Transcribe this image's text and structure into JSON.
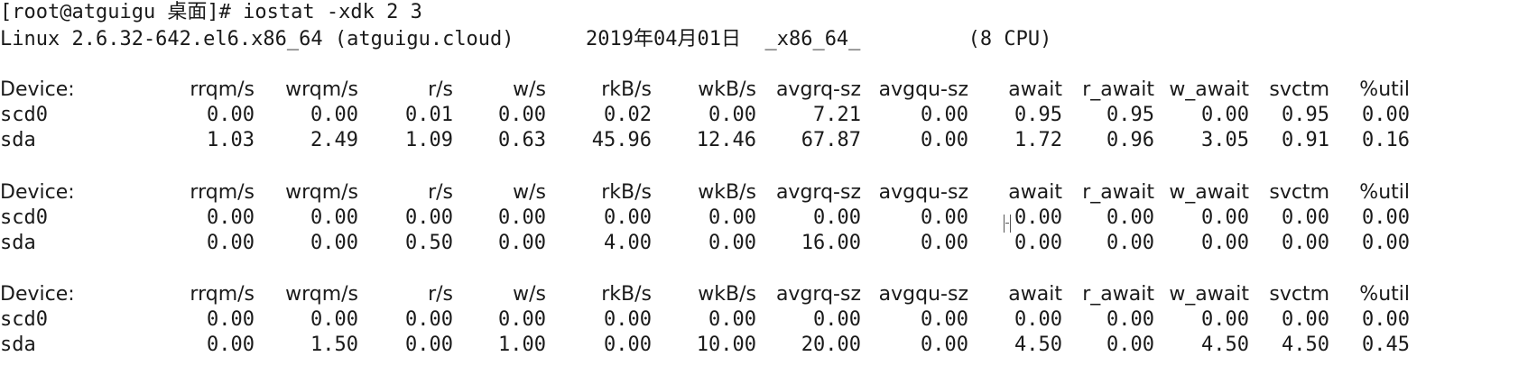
{
  "terminal": {
    "prompt_line": "[root@atguigu 桌面]# iostat -xdk 2 3",
    "sysinfo_line": "Linux 2.6.32-642.el6.x86_64 (atguigu.cloud)      2019年04月01日  _x86_64_         (8 CPU)",
    "columns": [
      "Device:",
      "rrqm/s",
      "wrqm/s",
      "r/s",
      "w/s",
      "rkB/s",
      "wkB/s",
      "avgrq-sz",
      "avgqu-sz",
      "await",
      "r_await",
      "w_await",
      "svctm",
      "%util"
    ],
    "reports": [
      {
        "rows": [
          [
            "scd0",
            "0.00",
            "0.00",
            "0.01",
            "0.00",
            "0.02",
            "0.00",
            "7.21",
            "0.00",
            "0.95",
            "0.95",
            "0.00",
            "0.95",
            "0.00"
          ],
          [
            "sda",
            "1.03",
            "2.49",
            "1.09",
            "0.63",
            "45.96",
            "12.46",
            "67.87",
            "0.00",
            "1.72",
            "0.96",
            "3.05",
            "0.91",
            "0.16"
          ]
        ]
      },
      {
        "rows": [
          [
            "scd0",
            "0.00",
            "0.00",
            "0.00",
            "0.00",
            "0.00",
            "0.00",
            "0.00",
            "0.00",
            "0.00",
            "0.00",
            "0.00",
            "0.00",
            "0.00"
          ],
          [
            "sda",
            "0.00",
            "0.00",
            "0.50",
            "0.00",
            "4.00",
            "0.00",
            "16.00",
            "0.00",
            "0.00",
            "0.00",
            "0.00",
            "0.00",
            "0.00"
          ]
        ]
      },
      {
        "rows": [
          [
            "scd0",
            "0.00",
            "0.00",
            "0.00",
            "0.00",
            "0.00",
            "0.00",
            "0.00",
            "0.00",
            "0.00",
            "0.00",
            "0.00",
            "0.00",
            "0.00"
          ],
          [
            "sda",
            "0.00",
            "1.50",
            "0.00",
            "1.00",
            "0.00",
            "10.00",
            "20.00",
            "0.00",
            "4.50",
            "0.00",
            "4.50",
            "4.50",
            "0.45"
          ]
        ]
      }
    ]
  }
}
